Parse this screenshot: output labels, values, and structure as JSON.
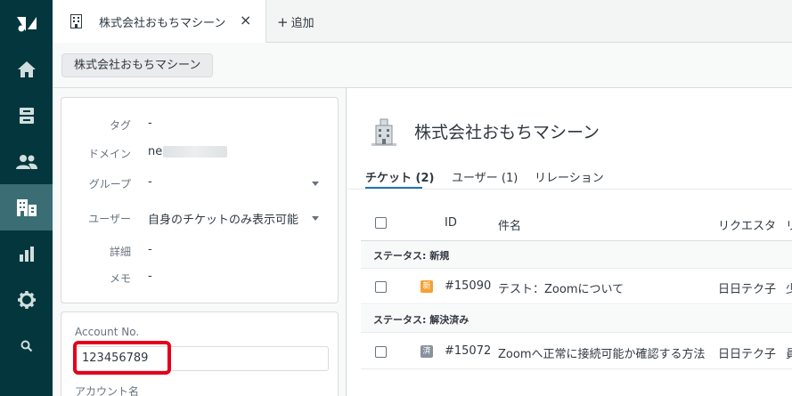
{
  "nav": {
    "logo_icon": "zendesk-logo",
    "items": [
      {
        "icon": "home-icon"
      },
      {
        "icon": "views-icon"
      },
      {
        "icon": "customers-icon"
      },
      {
        "icon": "organizations-icon",
        "active": true
      },
      {
        "icon": "reporting-icon"
      },
      {
        "icon": "admin-gear-icon"
      },
      {
        "icon": "search-icon"
      }
    ]
  },
  "tabbar": {
    "tab_title": "株式会社おもちマシーン",
    "close_glyph": "×",
    "add_label": "追加"
  },
  "breadcrumb": {
    "label": "株式会社おもちマシーン"
  },
  "org_fields": [
    {
      "label": "タグ",
      "value": "-"
    },
    {
      "label": "ドメイン",
      "value": "ne"
    },
    {
      "label": "グループ",
      "value": "-"
    },
    {
      "label": "ユーザー",
      "value": "自身のチケットのみ表示可能"
    },
    {
      "label": "詳細",
      "value": "-"
    },
    {
      "label": "メモ",
      "value": "-"
    }
  ],
  "account": {
    "label": "Account No.",
    "value": "123456789",
    "next_label": "アカウント名",
    "highlight_color": "#e3001b"
  },
  "main": {
    "title": "株式会社おもちマシーン",
    "tabs": [
      {
        "label": "チケット (2)",
        "active": true
      },
      {
        "label": "ユーザー (1)"
      },
      {
        "label": "リレーション"
      }
    ],
    "columns": [
      "ID",
      "件名",
      "リクエスタ",
      "リ"
    ],
    "groups": [
      {
        "label": "ステータス: 新規",
        "rows": [
          {
            "status": "新",
            "id": "#15090",
            "subject": "テスト：Zoomについて",
            "requester": "日日テク子",
            "extra": "少"
          }
        ]
      },
      {
        "label": "ステータス: 解決済み",
        "rows": [
          {
            "status": "済",
            "id": "#15072",
            "subject": "Zoomへ正常に接続可能か確認する方法",
            "requester": "日日テク子",
            "extra": "員"
          }
        ]
      }
    ]
  },
  "colors": {
    "nav_bg": "#03363d",
    "nav_active": "#3a6e74",
    "badge_new": "#f5a133",
    "badge_solved": "#87929d",
    "link_blue": "#1f73b7"
  }
}
